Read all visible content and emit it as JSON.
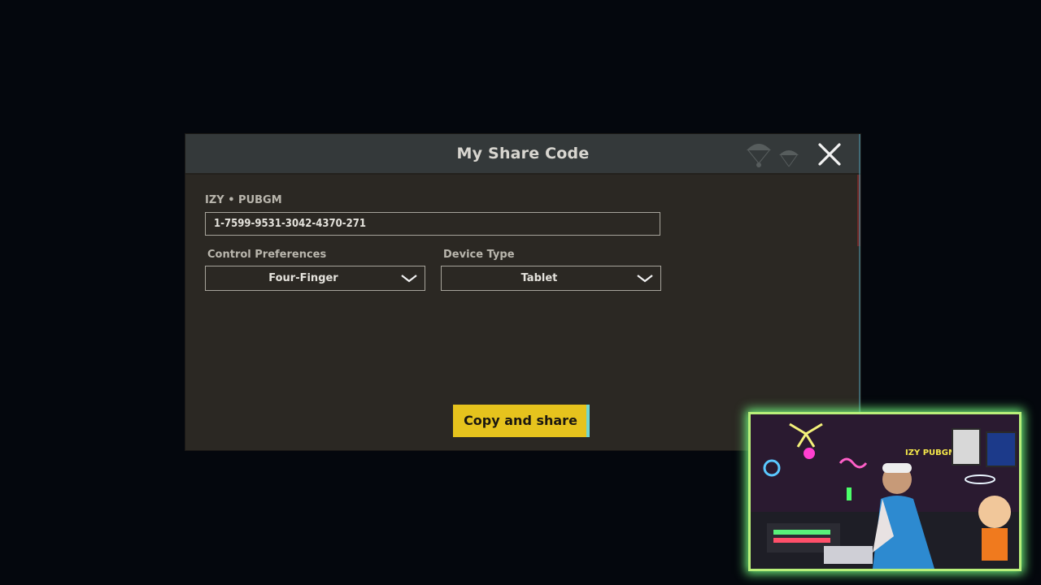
{
  "dialog": {
    "title": "My Share Code",
    "owner_label": "IZY • PUBGM",
    "share_code": "1-7599-9531-3042-4370-271",
    "control_preferences": {
      "label": "Control Preferences",
      "selected": "Four-Finger"
    },
    "device_type": {
      "label": "Device Type",
      "selected": "Tablet"
    },
    "copy_share_label": "Copy and share"
  },
  "webcam": {
    "sign_text": "IZY PUBGM"
  },
  "icons": {
    "close": "close-icon",
    "dropdown": "chevron-down-icon"
  },
  "colors": {
    "accent_button": "#e6c31d",
    "webcam_border": "#b8f07a",
    "background": "#04070d"
  }
}
